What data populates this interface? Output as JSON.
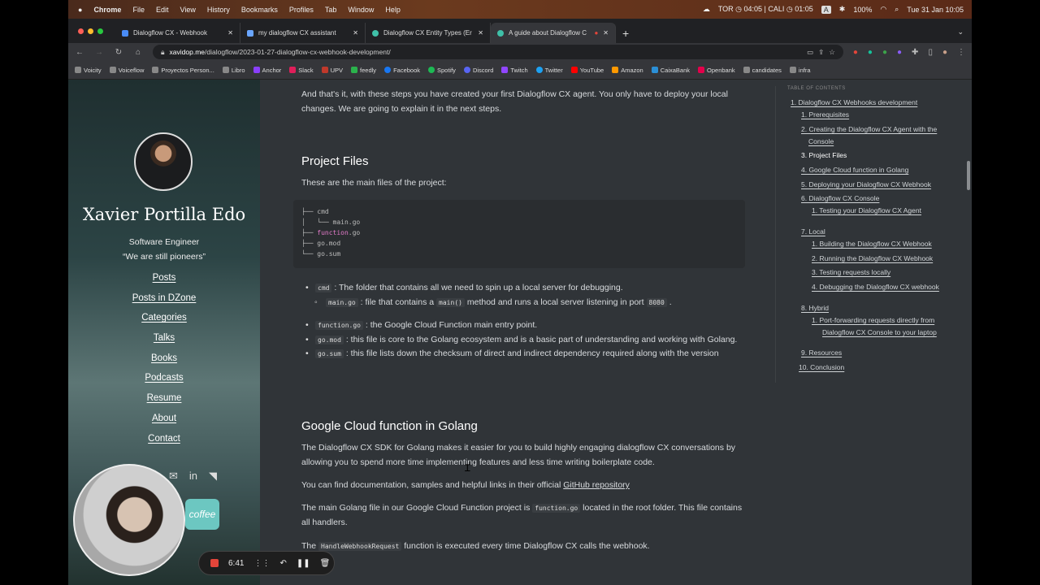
{
  "menubar": {
    "app": "Chrome",
    "menus": [
      "File",
      "Edit",
      "View",
      "History",
      "Bookmarks",
      "Profiles",
      "Tab",
      "Window",
      "Help"
    ],
    "status": {
      "timezones": "TOR ◷ 04:05 | CALI ◷ 01:05",
      "input_source": "A",
      "battery": "100%",
      "datetime": "Tue 31 Jan  10:05"
    }
  },
  "tabs": [
    {
      "title": "Dialogflow CX - Webhook",
      "color": "#4a8cf7"
    },
    {
      "title": "my dialogflow CX assistant",
      "color": "#6aa6ff"
    },
    {
      "title": "Dialogflow CX Entity Types (Er",
      "color": "#3fc0a8"
    },
    {
      "title": "A guide about Dialogflow C",
      "color": "#3fc0a8",
      "active": true
    }
  ],
  "address": {
    "host": "xavidop.me",
    "path": "/dialogflow/2023-01-27-dialogflow-cx-webhook-development/"
  },
  "bookmarks": [
    {
      "label": "Voicity",
      "color": "#888"
    },
    {
      "label": "Voiceflow",
      "color": "#888"
    },
    {
      "label": "Proyectos Person...",
      "color": "#888"
    },
    {
      "label": "Libro",
      "color": "#888"
    },
    {
      "label": "Anchor",
      "color": "#8a3ffc"
    },
    {
      "label": "Slack",
      "color": "#e01e5a"
    },
    {
      "label": "UPV",
      "color": "#c0392b"
    },
    {
      "label": "feedly",
      "color": "#2bb24c"
    },
    {
      "label": "Facebook",
      "color": "#1877f2"
    },
    {
      "label": "Spotify",
      "color": "#1db954"
    },
    {
      "label": "Discord",
      "color": "#5865f2"
    },
    {
      "label": "Twitch",
      "color": "#9146ff"
    },
    {
      "label": "Twitter",
      "color": "#1da1f2"
    },
    {
      "label": "YouTube",
      "color": "#ff0000"
    },
    {
      "label": "Amazon",
      "color": "#ff9900"
    },
    {
      "label": "CaixaBank",
      "color": "#2b8fd6"
    },
    {
      "label": "Openbank",
      "color": "#e3004b"
    },
    {
      "label": "candidates",
      "color": "#888"
    },
    {
      "label": "infra",
      "color": "#888"
    }
  ],
  "sidebar": {
    "name": "Xavier Portilla Edo",
    "role": "Software Engineer",
    "motto": "“We are still pioneers”",
    "nav": [
      "Posts",
      "Posts in DZone",
      "Categories",
      "Talks",
      "Books",
      "Podcasts",
      "Resume",
      "About",
      "Contact"
    ],
    "coffee": "coffee"
  },
  "recorder": {
    "time": "6:41"
  },
  "article": {
    "intro": "And that's it, with these steps you have created your first Dialogflow CX agent. You only have to deploy your local changes. We are going to explain it in the next steps.",
    "h_project_files": "Project Files",
    "files_intro": "These are the main files of the project:",
    "tree": {
      "l1": "├── cmd",
      "l2": "│   └── main.go",
      "l3a": "├── ",
      "l3b": "function",
      "l3c": ".go",
      "l4": "├── go.mod",
      "l5": "└── go.sum"
    },
    "files": {
      "cmd_code": "cmd",
      "cmd_text": ": The folder that contains all we need to spin up a local server for debugging.",
      "main_code": "main.go",
      "main_text1": ": file that contains a",
      "main_code2": "main()",
      "main_text2": "method and runs a local server listening in port",
      "main_port": "8080",
      "main_end": ".",
      "function_code": "function.go",
      "function_text": ": the Google Cloud Function main entry point.",
      "gomod_code": "go.mod",
      "gomod_text": ": this file is core to the Golang ecosystem and is a basic part of understanding and working with Golang.",
      "gosum_code": "go.sum",
      "gosum_text": ": this file lists down the checksum of direct and indirect dependency required along with the version"
    },
    "h_gcf": "Google Cloud function in Golang",
    "gcf_p1": "The Dialogflow CX SDK for Golang makes it easier for you to build highly engaging dialogflow CX conversations by allowing you to spend more time implementing features and less time writing boilerplate code.",
    "gcf_p2_text": "You can find documentation, samples and helpful links in their official",
    "gcf_p2_link": "GitHub repository",
    "gcf_p3_a": "The main Golang file in our Google Cloud Function project is",
    "gcf_p3_code": "function.go",
    "gcf_p3_b": "located in the root folder. This file contains all handlers.",
    "gcf_p4_a": "The",
    "gcf_p4_code": "HandleWebhookRequest",
    "gcf_p4_b": "function is executed every time Dialogflow CX calls the webhook."
  },
  "toc": {
    "heading": "TABLE OF CONTENTS",
    "items": [
      "1. Dialogflow CX Webhooks development",
      "1. Prerequisites",
      "2. Creating the Dialogflow CX Agent with the",
      "Console",
      "3. Project Files",
      "4. Google Cloud function in Golang",
      "5. Deploying your Dialogflow CX Webhook",
      "6. Dialogflow CX Console",
      "1. Testing your Dialogflow CX Agent",
      "7. Local",
      "1. Building the Dialogflow CX Webhook",
      "2. Running the Dialogflow CX Webhook",
      "3. Testing requests locally",
      "4. Debugging the Dialogflow CX webhook",
      "8. Hybrid",
      "1. Port-forwarding requests directly from",
      "Dialogflow CX Console to your laptop",
      "9. Resources",
      "10. Conclusion"
    ]
  }
}
